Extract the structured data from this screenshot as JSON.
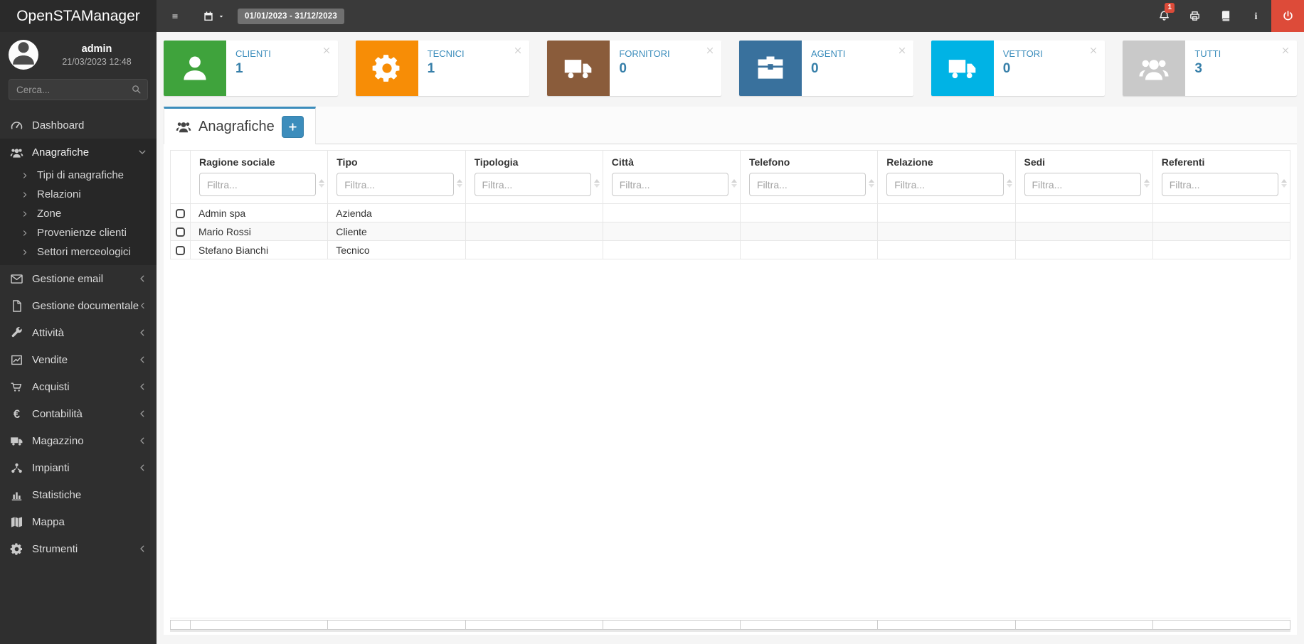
{
  "app": {
    "name": "OpenSTAManager"
  },
  "topbar": {
    "date_range": "01/01/2023 - 31/12/2023",
    "notification_count": "1",
    "action_icons": [
      "bell-icon",
      "printer-icon",
      "book-icon",
      "info-icon",
      "power-icon"
    ]
  },
  "sidebar": {
    "user": {
      "name": "admin",
      "datetime": "21/03/2023 12:48"
    },
    "search": {
      "placeholder": "Cerca..."
    },
    "items": [
      {
        "label": "Dashboard",
        "icon": "dashboard-icon",
        "has_children": false
      },
      {
        "label": "Anagrafiche",
        "icon": "users-icon",
        "has_children": true,
        "expanded": true,
        "children": [
          "Tipi di anagrafiche",
          "Relazioni",
          "Zone",
          "Provenienze clienti",
          "Settori merceologici"
        ]
      },
      {
        "label": "Gestione email",
        "icon": "envelope-icon",
        "has_children": true
      },
      {
        "label": "Gestione documentale",
        "icon": "document-icon",
        "has_children": true
      },
      {
        "label": "Attività",
        "icon": "wrench-icon",
        "has_children": true
      },
      {
        "label": "Vendite",
        "icon": "chart-line-icon",
        "has_children": true
      },
      {
        "label": "Acquisti",
        "icon": "cart-icon",
        "has_children": true
      },
      {
        "label": "Contabilità",
        "icon": "euro-icon",
        "has_children": true
      },
      {
        "label": "Magazzino",
        "icon": "truck-icon",
        "has_children": true
      },
      {
        "label": "Impianti",
        "icon": "network-icon",
        "has_children": true
      },
      {
        "label": "Statistiche",
        "icon": "bar-chart-icon",
        "has_children": false
      },
      {
        "label": "Mappa",
        "icon": "map-icon",
        "has_children": false
      },
      {
        "label": "Strumenti",
        "icon": "gear-icon",
        "has_children": true
      }
    ]
  },
  "infoboxes": [
    {
      "label": "CLIENTI",
      "value": "1",
      "color": "#3fa33c",
      "icon": "user-icon"
    },
    {
      "label": "TECNICI",
      "value": "1",
      "color": "#f78d06",
      "icon": "gear-icon"
    },
    {
      "label": "FORNITORI",
      "value": "0",
      "color": "#8a5c3b",
      "icon": "truck-icon"
    },
    {
      "label": "AGENTI",
      "value": "0",
      "color": "#39719d",
      "icon": "briefcase-icon"
    },
    {
      "label": "VETTORI",
      "value": "0",
      "color": "#00b3e5",
      "icon": "truck-icon"
    },
    {
      "label": "TUTTI",
      "value": "3",
      "color": "#c9c9c9",
      "icon": "users-icon"
    }
  ],
  "panel": {
    "tab_title": "Anagrafiche",
    "tab_icon": "users-icon",
    "add_button_icon": "plus-icon"
  },
  "table": {
    "filter_placeholder": "Filtra...",
    "columns": [
      "Ragione sociale",
      "Tipo",
      "Tipologia",
      "Città",
      "Telefono",
      "Relazione",
      "Sedi",
      "Referenti"
    ],
    "rows": [
      [
        "Admin spa",
        "Azienda",
        "",
        "",
        "",
        "",
        "",
        ""
      ],
      [
        "Mario Rossi",
        "Cliente",
        "",
        "",
        "",
        "",
        "",
        ""
      ],
      [
        "Stefano Bianchi",
        "Tecnico",
        "",
        "",
        "",
        "",
        "",
        ""
      ]
    ]
  },
  "colors": {
    "accent": "#3c8dbc",
    "value_text": "#367fa9",
    "danger": "#dd4b39",
    "date_badge_bg": "#707070"
  }
}
